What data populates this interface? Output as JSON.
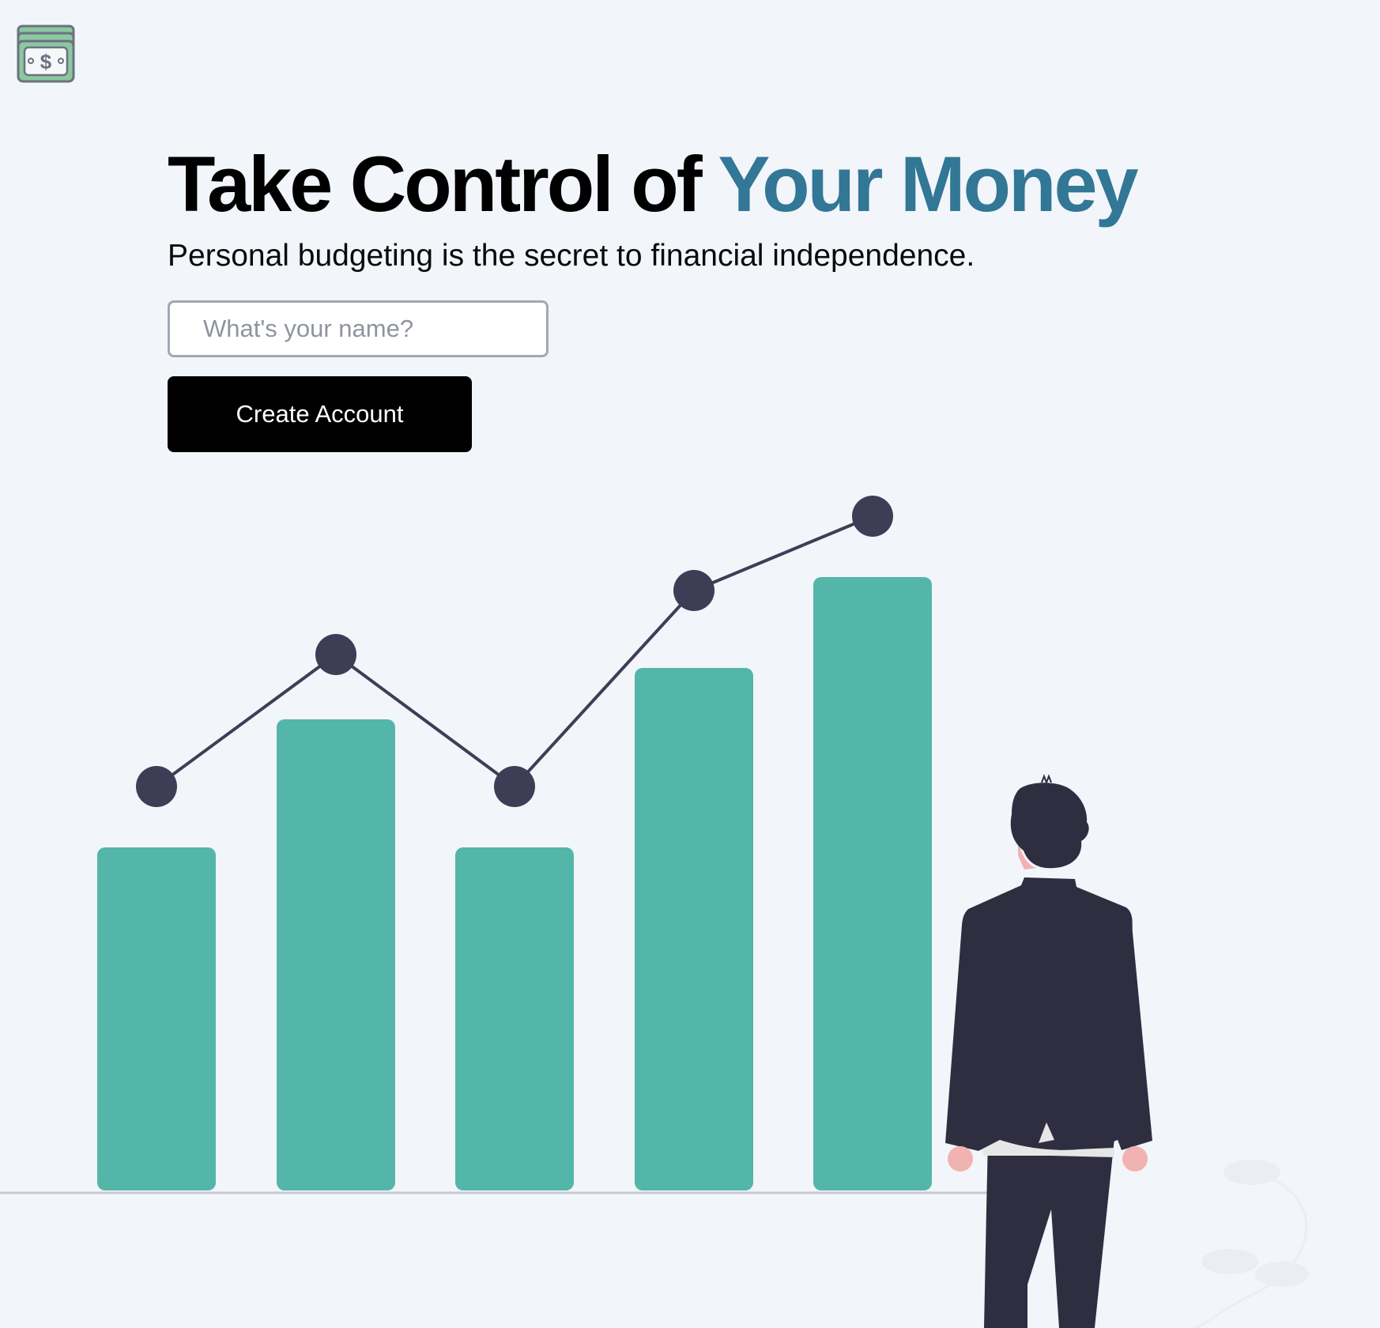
{
  "brand": {
    "logo_icon": "cash-stack-icon",
    "logo_color": "#8cc7a1"
  },
  "hero": {
    "headline_plain": "Take Control of ",
    "headline_accent": "Your Money",
    "accent_color": "#327795",
    "subhead": "Personal budgeting is the secret to financial independence."
  },
  "form": {
    "name_placeholder": "What's your name?",
    "name_value": "",
    "submit_label": "Create Account"
  },
  "illustration": {
    "bar_color": "#54b6a8",
    "line_color": "#3f3d56",
    "figure_color": "#2f2e41",
    "skin_color": "#f1b2b2"
  }
}
